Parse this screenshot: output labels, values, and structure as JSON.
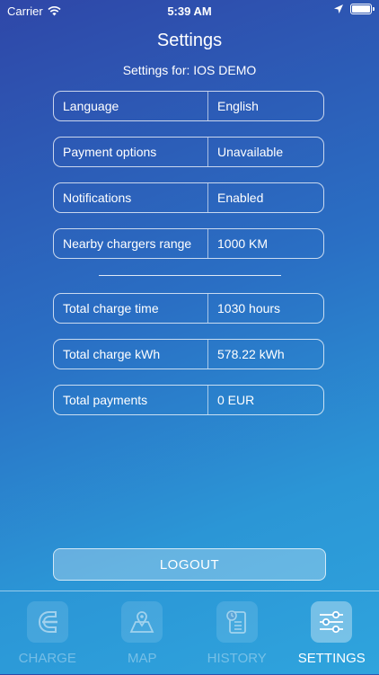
{
  "status": {
    "carrier": "Carrier",
    "time": "5:39 AM"
  },
  "header": {
    "title": "Settings",
    "subtitle": "Settings for: IOS DEMO"
  },
  "settings": [
    {
      "label": "Language",
      "value": "English"
    },
    {
      "label": "Payment options",
      "value": "Unavailable"
    },
    {
      "label": "Notifications",
      "value": "Enabled"
    },
    {
      "label": "Nearby chargers range",
      "value": "1000 KM"
    }
  ],
  "stats": [
    {
      "label": "Total charge time",
      "value": "1030 hours"
    },
    {
      "label": "Total charge kWh",
      "value": "578.22 kWh"
    },
    {
      "label": "Total payments",
      "value": "0 EUR"
    }
  ],
  "logout_label": "LOGOUT",
  "tabs": [
    {
      "label": "CHARGE",
      "icon": "charge-icon"
    },
    {
      "label": "MAP",
      "icon": "map-icon"
    },
    {
      "label": "HISTORY",
      "icon": "history-icon"
    },
    {
      "label": "SETTINGS",
      "icon": "settings-sliders-icon"
    }
  ],
  "active_tab": "SETTINGS"
}
